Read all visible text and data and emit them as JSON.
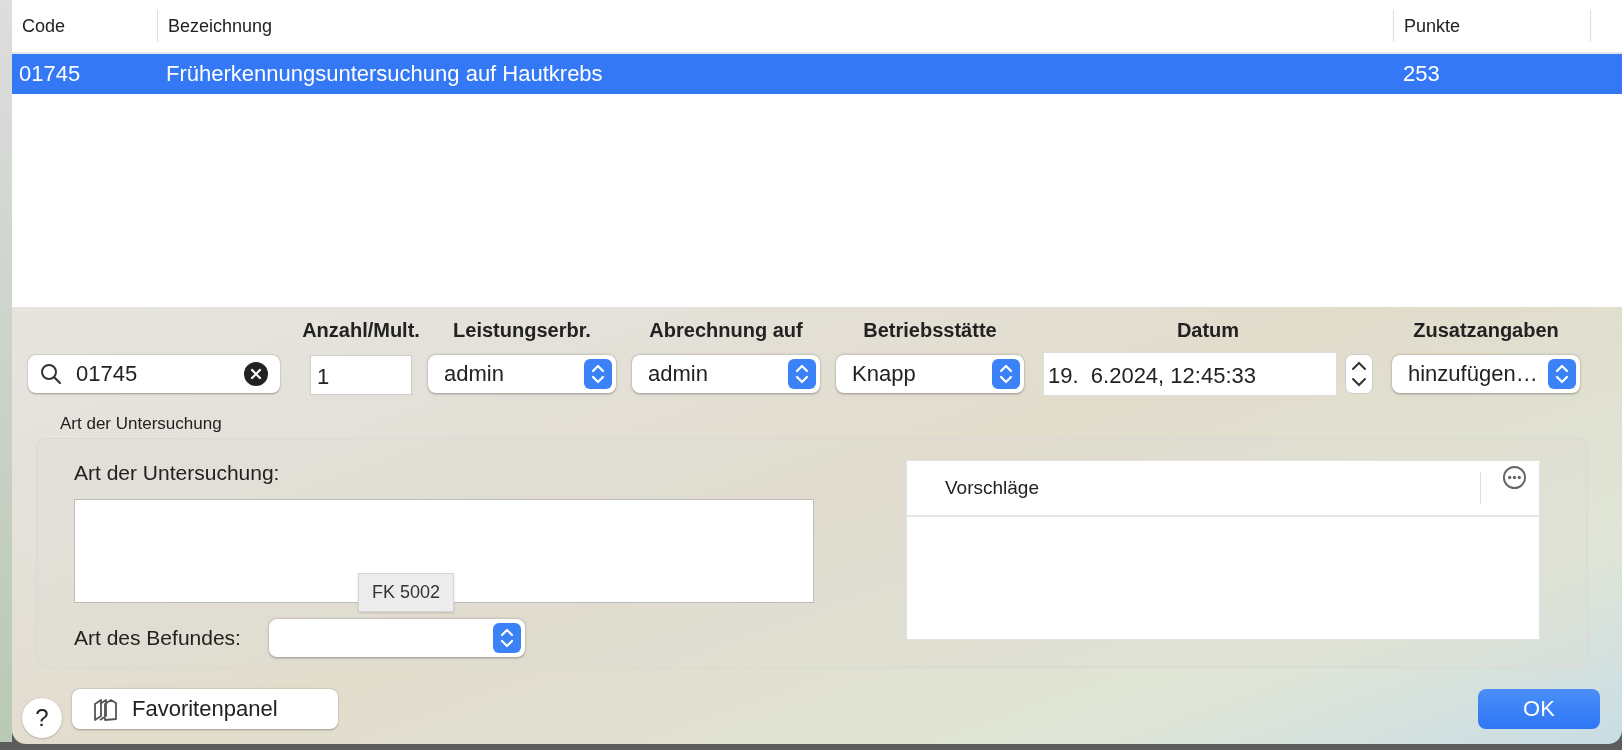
{
  "table": {
    "columns": [
      "Code",
      "Bezeichnung",
      "Punkte"
    ],
    "rows": [
      {
        "cells": [
          "01745",
          "Früherkennungsuntersuchung auf Hautkrebs",
          "253"
        ],
        "selected": true
      }
    ]
  },
  "search": {
    "value": "01745"
  },
  "fields": [
    {
      "kind": "text",
      "label": "Anzahl/Mult.",
      "value": "1"
    },
    {
      "kind": "select",
      "label": "Leistungserbr.",
      "value": "admin"
    },
    {
      "kind": "select",
      "label": "Abrechnung auf",
      "value": "admin"
    },
    {
      "kind": "select",
      "label": "Betriebsstätte",
      "value": "Knapp"
    },
    {
      "kind": "date",
      "label": "Datum",
      "value": "19.  6.2024, 12:45:33"
    },
    {
      "kind": "select",
      "label": "Zusatzangaben",
      "value": "hinzufügen…"
    }
  ],
  "group": {
    "title": "Art der Untersuchung",
    "exam_label": "Art der Untersuchung:",
    "finding_label": "Art des Befundes:",
    "tooltip": "FK 5002",
    "suggestions": {
      "columns": [
        "Vorschläge"
      ]
    }
  },
  "buttons": {
    "help": "?",
    "favorites": "Favoritenpanel",
    "ok": "OK"
  }
}
